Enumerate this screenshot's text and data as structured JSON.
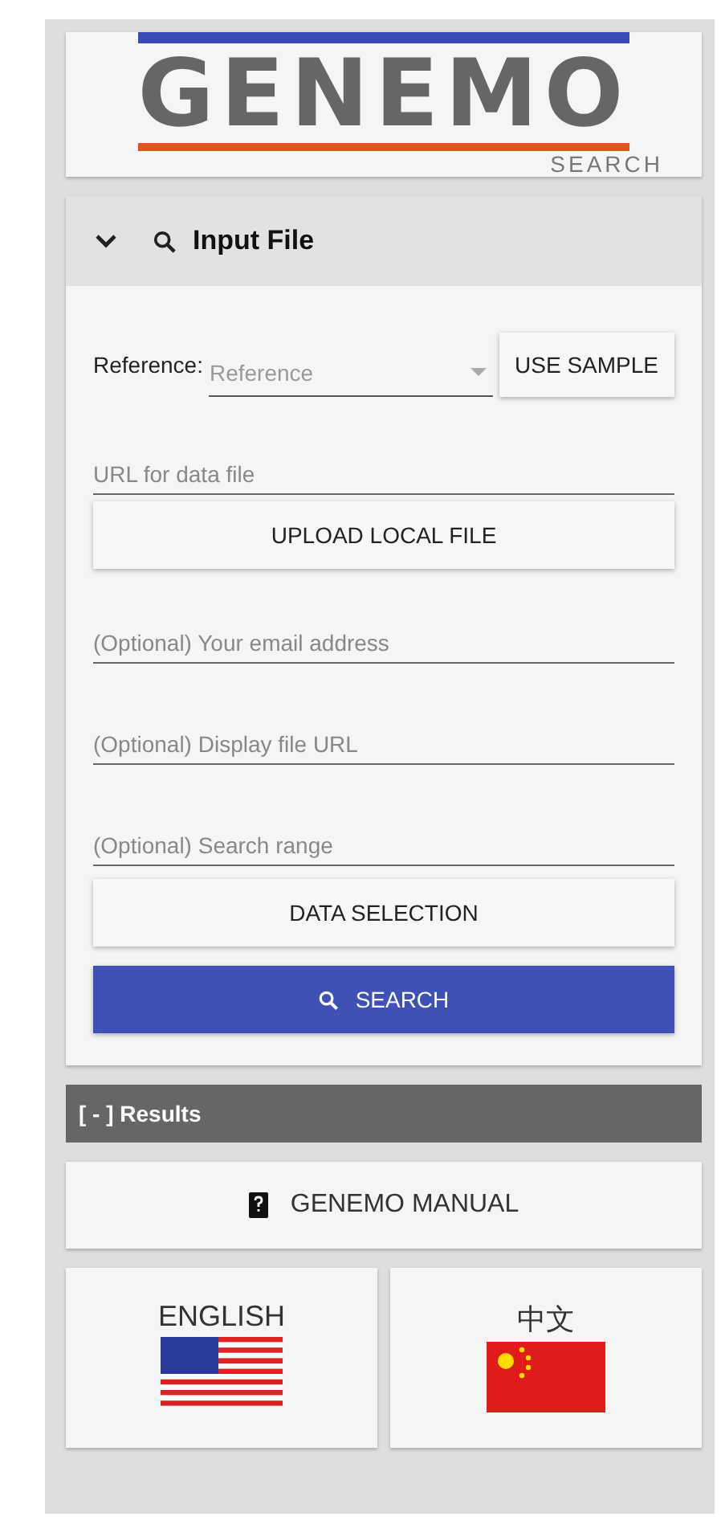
{
  "logo": {
    "title": "GENEMO",
    "subtitle": "SEARCH"
  },
  "input_panel": {
    "title": "Input File",
    "expanded": true,
    "reference": {
      "label": "Reference:",
      "placeholder": "Reference"
    },
    "use_sample_button": "USE SAMPLE",
    "url_field": {
      "placeholder": "URL for data file"
    },
    "upload_button": "UPLOAD LOCAL FILE",
    "email_field": {
      "placeholder": "(Optional) Your email address"
    },
    "display_url_field": {
      "placeholder": "(Optional) Display file URL"
    },
    "range_field": {
      "placeholder": "(Optional) Search range"
    },
    "data_selection_button": "DATA SELECTION",
    "search_button": "SEARCH"
  },
  "results_bar": {
    "label": "[ - ] Results"
  },
  "manual_button": "GENEMO MANUAL",
  "languages": [
    {
      "label": "ENGLISH",
      "kind": "us"
    },
    {
      "label": "中文",
      "kind": "cn"
    }
  ]
}
